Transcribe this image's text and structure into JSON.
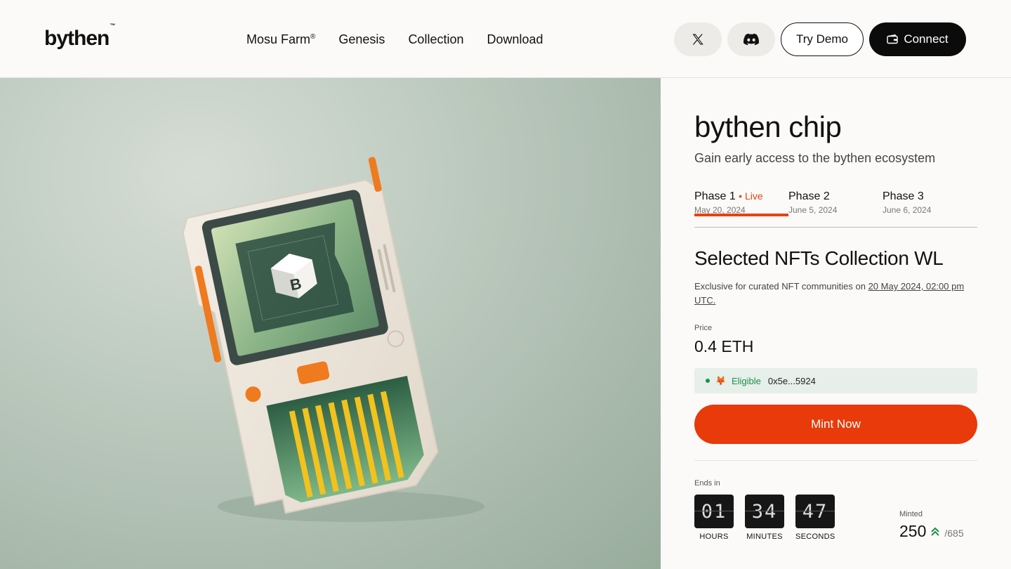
{
  "header": {
    "logo": "bythen",
    "logo_tm": "™",
    "nav": [
      {
        "label": "Mosu Farm",
        "sup": "®"
      },
      {
        "label": "Genesis"
      },
      {
        "label": "Collection"
      },
      {
        "label": "Download"
      }
    ],
    "try_demo_label": "Try Demo",
    "connect_label": "Connect",
    "social_icons": [
      "x-icon",
      "discord-icon"
    ]
  },
  "hero": {
    "image": "bythen-chip-device-illustration",
    "screen_logo": "B",
    "screen_tm": "™"
  },
  "panel": {
    "title": "bythen chip",
    "subtitle": "Gain early access to the bythen ecosystem",
    "phases": [
      {
        "name": "Phase 1",
        "live": "• Live",
        "date": "May 20, 2024"
      },
      {
        "name": "Phase 2",
        "date": "June 5, 2024"
      },
      {
        "name": "Phase 3",
        "date": "June 6, 2024"
      }
    ],
    "heading": "Selected NFTs Collection WL",
    "description_prefix": "Exclusive for curated NFT communities on ",
    "description_date": "20 May 2024, 02:00 pm UTC.",
    "price_label": "Price",
    "price": "0.4 ETH",
    "eligibility": {
      "status": "Eligible",
      "wallet_icon": "metamask-fox-icon",
      "address": "0x5e...5924"
    },
    "mint_label": "Mint Now",
    "ends_label": "Ends in",
    "countdown": [
      {
        "value": "01",
        "unit": "HOURS"
      },
      {
        "value": "34",
        "unit": "MINUTES"
      },
      {
        "value": "47",
        "unit": "SECONDS"
      }
    ],
    "minted_label": "Minted",
    "minted_count": "250",
    "minted_total": "/685"
  },
  "colors": {
    "accent": "#e83a0a",
    "success": "#1f8f4e",
    "dark": "#0b0b0b",
    "hero_bg": "#b8c6ba"
  }
}
